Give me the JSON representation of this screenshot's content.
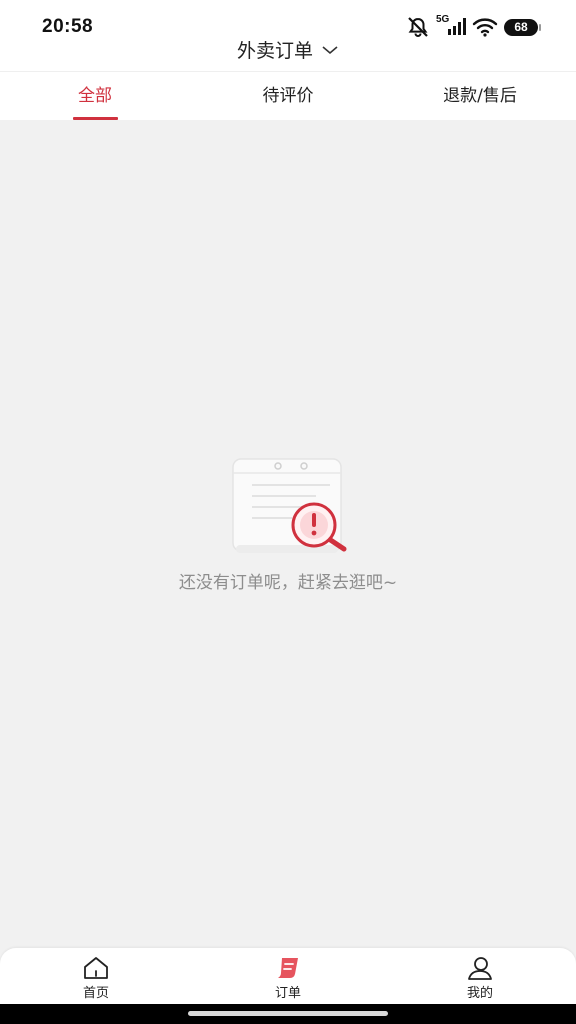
{
  "status_bar": {
    "time": "20:58",
    "network_label": "5G",
    "battery_level": "68",
    "icons": [
      "bell-muted-icon",
      "signal-icon",
      "wifi-icon",
      "battery-icon"
    ]
  },
  "header": {
    "title": "外卖订单"
  },
  "tabs": [
    {
      "label": "全部",
      "active": true
    },
    {
      "label": "待评价",
      "active": false
    },
    {
      "label": "退款/售后",
      "active": false
    }
  ],
  "empty_state": {
    "message": "还没有订单呢，赶紧去逛吧~"
  },
  "bottom_nav": {
    "items": [
      {
        "label": "首页",
        "icon": "home-icon",
        "active": false
      },
      {
        "label": "订单",
        "icon": "order-icon",
        "active": true
      },
      {
        "label": "我的",
        "icon": "profile-icon",
        "active": false
      }
    ]
  },
  "colors": {
    "accent": "#d0313e",
    "background": "#f1f1f1",
    "muted_text": "#8d8d8d"
  }
}
